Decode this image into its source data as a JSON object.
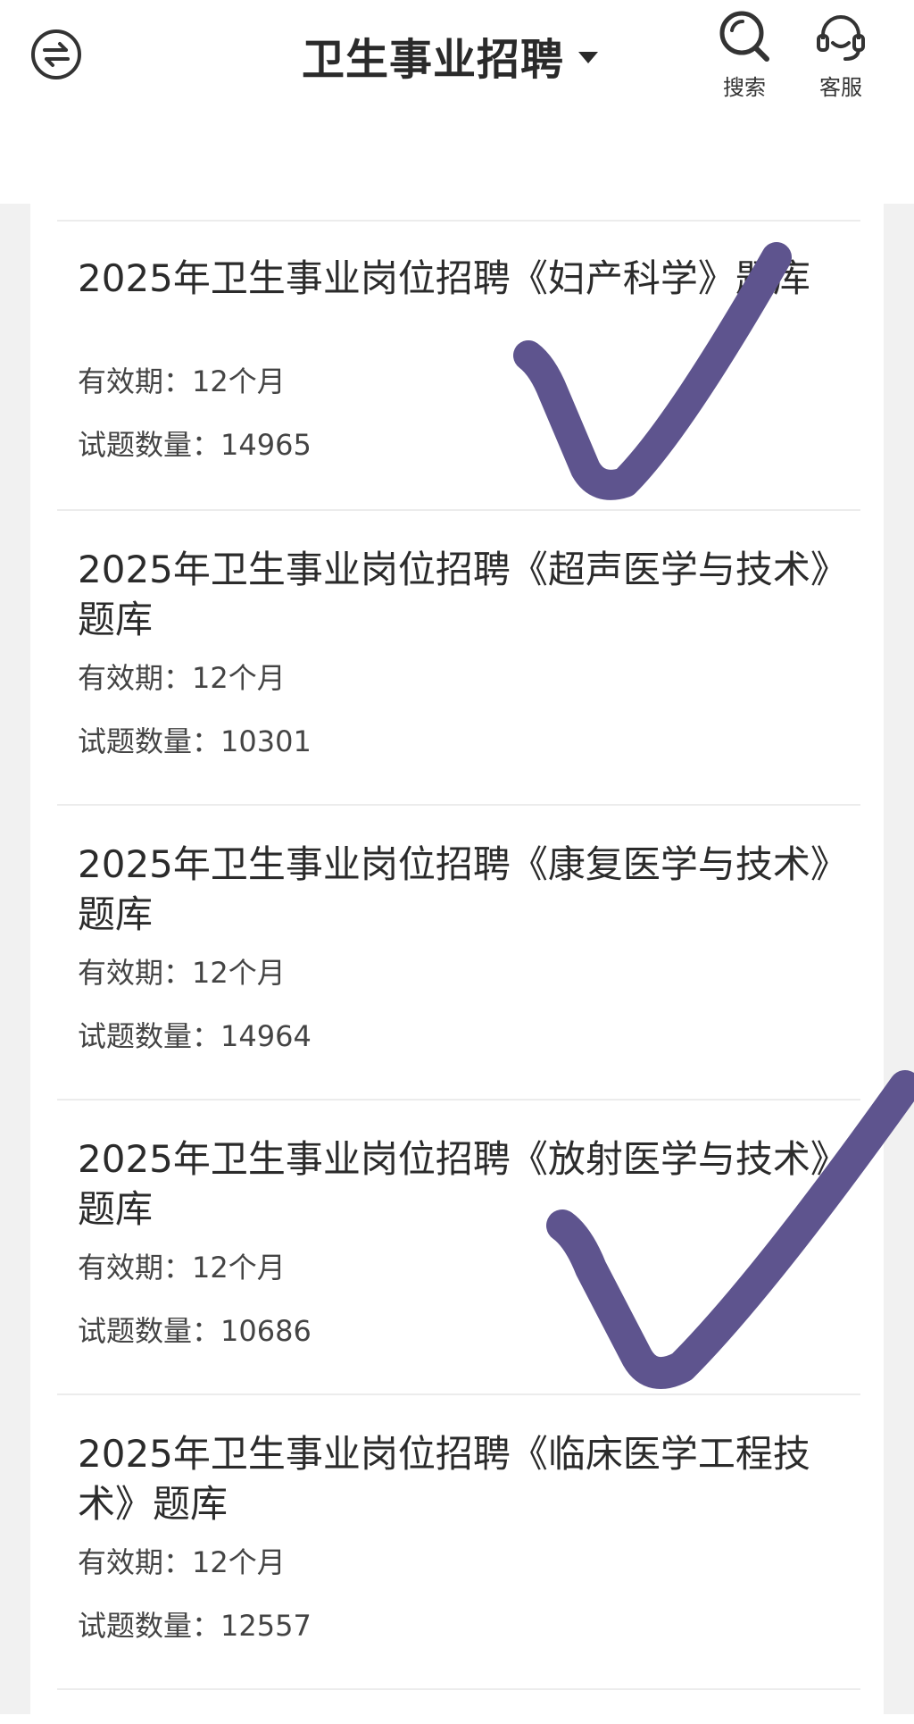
{
  "header": {
    "title": "卫生事业招聘",
    "search_label": "搜索",
    "service_label": "客服",
    "menu_icon": "swap-circle-icon",
    "search_icon": "search-icon",
    "service_icon": "headset-icon"
  },
  "items": [
    {
      "title": "2025年卫生事业岗位招聘《妇产科学》题库",
      "validity": "有效期：12个月",
      "count": "试题数量：14965"
    },
    {
      "title": "2025年卫生事业岗位招聘《超声医学与技术》题库",
      "validity": "有效期：12个月",
      "count": "试题数量：10301"
    },
    {
      "title": "2025年卫生事业岗位招聘《康复医学与技术》题库",
      "validity": "有效期：12个月",
      "count": "试题数量：14964"
    },
    {
      "title": "2025年卫生事业岗位招聘《放射医学与技术》题库",
      "validity": "有效期：12个月",
      "count": "试题数量：10686"
    },
    {
      "title": "2025年卫生事业岗位招聘《临床医学工程技术》题库",
      "validity": "有效期：12个月",
      "count": "试题数量：12557"
    }
  ],
  "annotations": {
    "checkmark_color": "#5e548e",
    "marked_items": [
      1,
      4
    ]
  }
}
